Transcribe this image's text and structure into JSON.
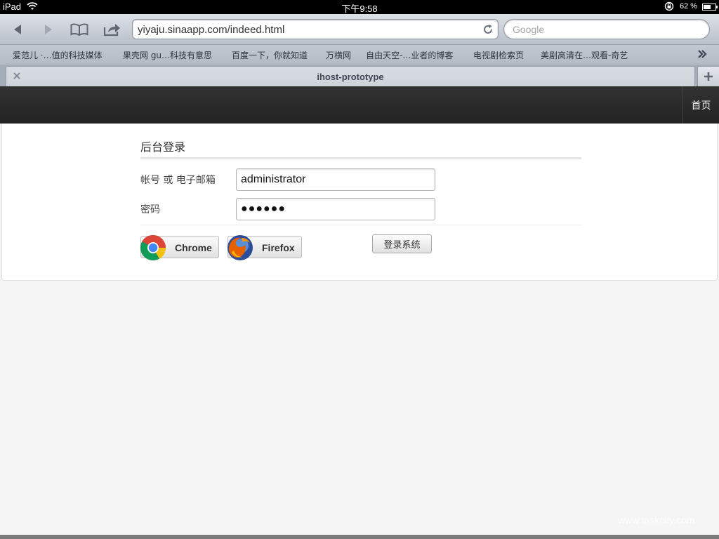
{
  "status_bar": {
    "carrier": "iPad",
    "time": "下午9:58",
    "battery_percent": "62 %",
    "battery_level": 0.62
  },
  "toolbar": {
    "icons": [
      "back-icon",
      "forward-icon",
      "bookmarks-icon",
      "share-icon",
      "reload-icon"
    ],
    "url": "yiyaju.sinaapp.com/indeed.html",
    "search_placeholder": "Google"
  },
  "bookmarks": [
    "爱范儿 ·…值的科技媒体",
    "果壳网 gu…科技有意思",
    "百度一下，你就知道",
    "万横网",
    "自由天空-…业者的博客",
    "电视剧检索页",
    "美剧高清在…观看-奇艺"
  ],
  "tab": {
    "title": "ihost-prototype"
  },
  "navbar": {
    "home_label": "首页"
  },
  "login": {
    "legend": "后台登录",
    "account_label": "帐号 或 电子邮箱",
    "account_value": "administrator",
    "password_label": "密码",
    "password_value": "●●●●●●",
    "chrome_label": "Chrome",
    "firefox_label": "Firefox",
    "submit_label": "登录系统"
  },
  "watermark": "www.taskcity.com",
  "colors": {
    "navbar": "#2b2b2b",
    "toolbar": "#c8cdd5",
    "page_bg": "#f5f5f5"
  }
}
